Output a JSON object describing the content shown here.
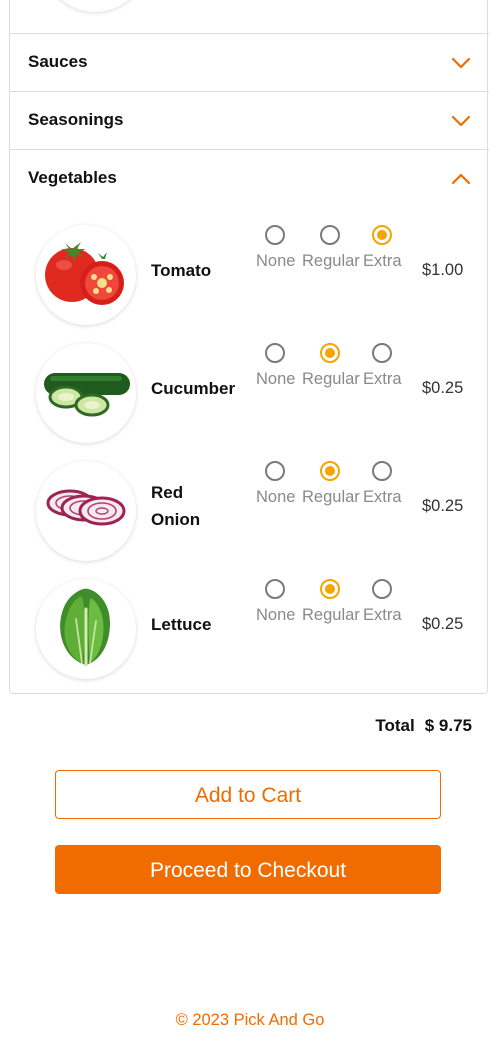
{
  "categories": [
    {
      "label": "Sauces",
      "expanded": false
    },
    {
      "label": "Seasonings",
      "expanded": false
    },
    {
      "label": "Vegetables",
      "expanded": true
    }
  ],
  "option_labels": [
    "None",
    "Regular",
    "Extra"
  ],
  "vegetables": [
    {
      "name_lines": [
        "Tomato"
      ],
      "selected": "Extra",
      "price": "$1.00",
      "icon": "tomato-icon"
    },
    {
      "name_lines": [
        "Cucumber"
      ],
      "selected": "Regular",
      "price": "$0.25",
      "icon": "cucumber-icon"
    },
    {
      "name_lines": [
        "Red",
        "Onion"
      ],
      "selected": "Regular",
      "price": "$0.25",
      "icon": "red-onion-icon"
    },
    {
      "name_lines": [
        "Lettuce"
      ],
      "selected": "Regular",
      "price": "$0.25",
      "icon": "lettuce-icon"
    }
  ],
  "total": {
    "label": "Total",
    "value": "$ 9.75"
  },
  "buttons": {
    "add_to_cart": "Add to Cart",
    "checkout": "Proceed to Checkout"
  },
  "footer": "© 2023 Pick And Go",
  "colors": {
    "accent": "#f06c00",
    "radio_selected": "#f5a400",
    "radio_unselected": "#7a7a7a",
    "border": "#dcdcdc"
  }
}
